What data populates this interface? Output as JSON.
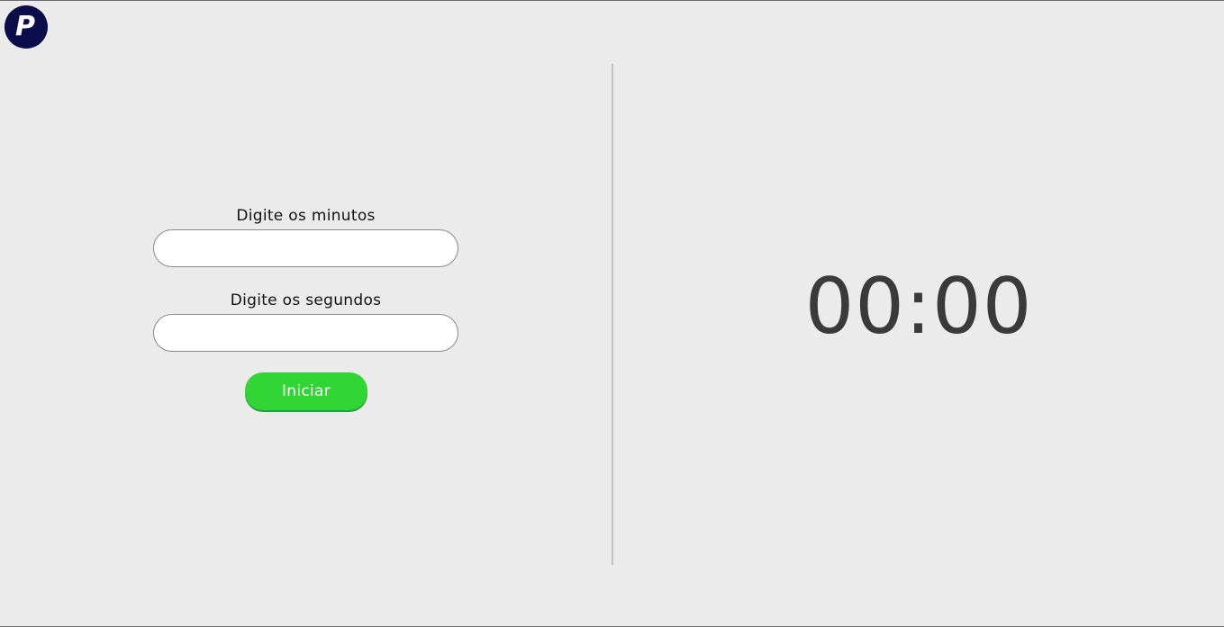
{
  "logo": {
    "letter": "P",
    "color": "#0b0c4a"
  },
  "form": {
    "minutes_label": "Digite os minutos",
    "minutes_value": "",
    "seconds_label": "Digite os segundos",
    "seconds_value": "",
    "start_button_label": "Iniciar",
    "start_button_color": "#31d534"
  },
  "timer": {
    "display": "00:00"
  },
  "colors": {
    "background": "#ebebeb",
    "divider": "#c4c4c4",
    "timer_text": "#3a3a3a"
  }
}
